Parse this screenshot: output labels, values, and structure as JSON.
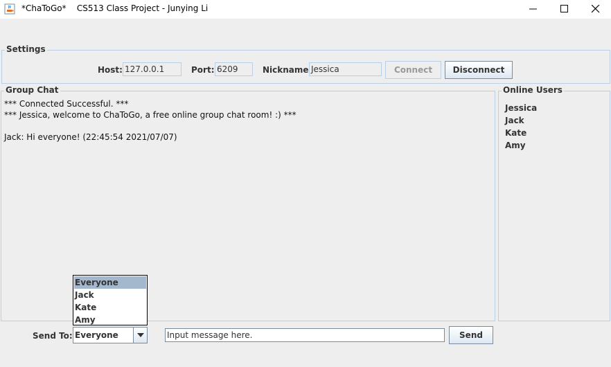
{
  "window": {
    "title": "*ChaToGo*    CS513 Class Project - Junying Li",
    "icons": [
      "java-app-icon",
      "minimize-icon",
      "maximize-icon",
      "close-icon"
    ]
  },
  "settings": {
    "group_title": "Settings",
    "host_label": "Host:",
    "host_value": "127.0.0.1",
    "port_label": "Port:",
    "port_value": "6209",
    "nickname_label": "Nickname:",
    "nickname_value": "Jessica",
    "connect_label": "Connect",
    "disconnect_label": "Disconnect"
  },
  "group_chat": {
    "title": "Group Chat",
    "messages": [
      "*** Connected Successful. ***",
      "*** Jessica, welcome to ChaToGo, a free online group chat room! :) ***",
      "",
      "Jack: Hi everyone! (22:45:54 2021/07/07)"
    ]
  },
  "online_users": {
    "title": "Online Users",
    "users": [
      "Jessica",
      "Jack",
      "Kate",
      "Amy"
    ]
  },
  "send": {
    "send_to_label": "Send To:",
    "selected_recipient": "Everyone",
    "options": [
      "Everyone",
      "Jack",
      "Kate",
      "Amy"
    ],
    "message_value": "Input message here.",
    "send_label": "Send"
  },
  "colors": {
    "background": "#eeeeee",
    "border": "#b8cfe5",
    "selection": "#a3b8cc"
  }
}
